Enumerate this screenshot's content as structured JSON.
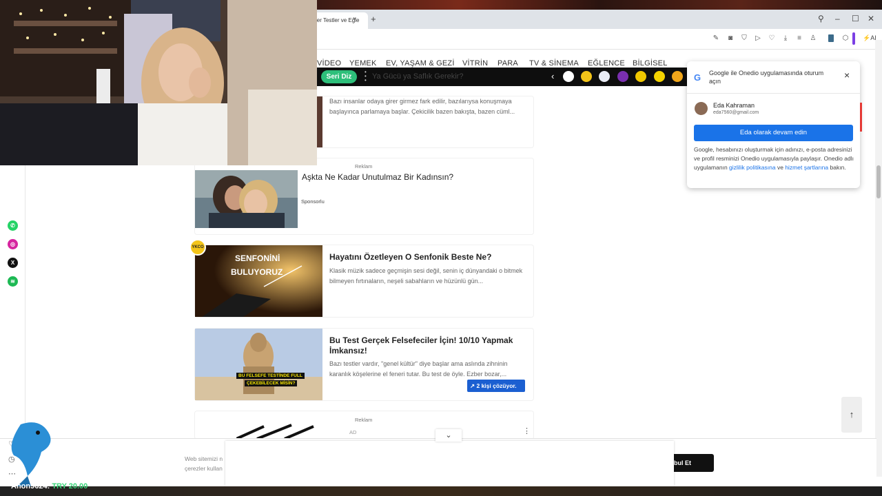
{
  "browser": {
    "tab_title": "ler Testler ve Eğle",
    "tab_close": "×",
    "new_tab": "+",
    "ai_label": "AI"
  },
  "nav": {
    "items": [
      "VİDEO",
      "YEMEK",
      "EV, YAŞAM & GEZİ",
      "VİTRİN",
      "PARA",
      "TV & SİNEMA",
      "EĞLENCE",
      "BİLGİSEL"
    ]
  },
  "subbar": {
    "seri_label": "Seri Diz",
    "ghost_text": "Ya Gücü ya Saflık Gerekir?",
    "story_colors": [
      "#ffffff",
      "#f3c419",
      "#e9ecf5",
      "#7a2fb0",
      "#f0c800",
      "#f5d300",
      "#f2a71b"
    ]
  },
  "feed": {
    "card0": {
      "desc": "Bazı insanlar odaya girer girmez fark edilir, bazılarıysa konuşmaya başlayınca parlamaya başlar. Çekicilik bazen bakışta, bazen cüml..."
    },
    "ad1": {
      "reklam": "Reklam",
      "title": "Aşkta Ne Kadar Unutulmaz Bir Kadınsın?",
      "sponsor": "Sponsorlu"
    },
    "card2": {
      "badge": "YKCO",
      "thumb_line1": "SENFONİNİ",
      "thumb_line2": "BULUYORUZ",
      "title": "Hayatını Özetleyen O Senfonik Beste Ne?",
      "desc": "Klasik müzik sadece geçmişin sesi değil, senin iç dünyandaki o bitmek bilmeyen fırtınaların, neşeli sabahların ve hüzünlü gün..."
    },
    "card3": {
      "thumb_line1": "BU FELSEFE TESTİNDE FULL",
      "thumb_line2": "ÇEKEBİLECEK MİSİN?",
      "title": "Bu Test Gerçek Felsefeciler İçin! 10/10 Yapmak İmkansız!",
      "desc": "Bazı testler vardır, \"genel kültür\" diye başlar ama aslında zihninin karanlık köşelerine el feneri tutar. Bu test de öyle. Ezber bozar,...",
      "solving": "2 kişi çözüyor."
    },
    "ad4": {
      "reklam": "Reklam",
      "ad_tag": "AD"
    }
  },
  "google_popup": {
    "g": "G",
    "title": "Google ile Onedio uygulamasında oturum açın",
    "close": "×",
    "user_name": "Eda Kahraman",
    "user_email": "eda7560@gmail.com",
    "continue_button": "Eda olarak devam edin",
    "fine_1": "Google, hesabınızı oluşturmak için adınızı, e-posta adresinizi ve profil resminizi Onedio uygulamasıyla paylaşır. Onedio adlı uygulamanın ",
    "privacy_link": "gizlilik politikasına",
    "fine_2": " ve ",
    "terms_link": "hizmet şartlarına",
    "fine_3": " bakın."
  },
  "cookie": {
    "line1": "Web sitemizi n",
    "line2": "çerezler kullan",
    "accept": "bul Et",
    "ad_toggle": "⌄"
  },
  "scroll_top": "↑",
  "stream": {
    "chat_user": "Anon9624:",
    "chat_amount": "TRY 20.00"
  },
  "colors": {
    "accent_green": "#2dbf7a",
    "google_blue": "#1a73e8",
    "solve_blue": "#1b5fd1"
  }
}
